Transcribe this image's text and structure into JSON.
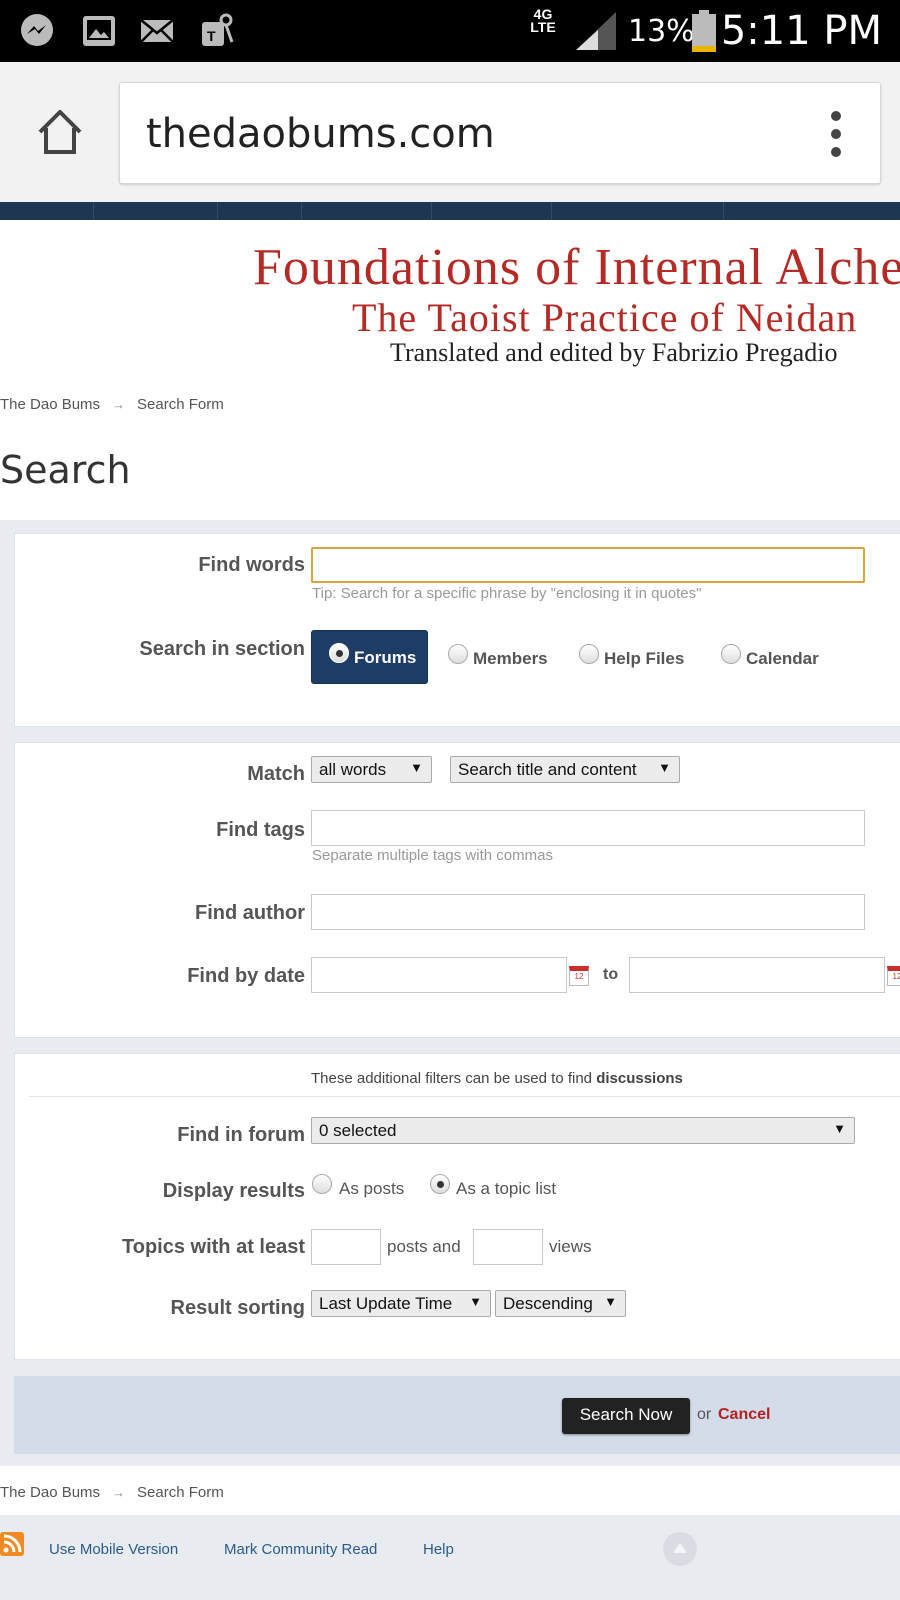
{
  "status_bar": {
    "battery_pct": "13%",
    "time": "5:11 PM",
    "network": "4G LTE"
  },
  "browser": {
    "url": "thedaobums.com"
  },
  "banner": {
    "line1": "Foundations of Internal Alchemy",
    "line2": "The Taoist Practice of Neidan",
    "line3": "Translated and edited by Fabrizio Pregadio"
  },
  "breadcrumb": {
    "home": "The Dao Bums",
    "sep": "→",
    "current": "Search Form"
  },
  "page_title": "Search",
  "form": {
    "find_words_label": "Find words",
    "find_words_value": "",
    "find_words_tip": "Tip: Search for a specific phrase by \"enclosing it in quotes\"",
    "section_label": "Search in section",
    "sections": [
      {
        "label": "Forums",
        "selected": true
      },
      {
        "label": "Members",
        "selected": false
      },
      {
        "label": "Help Files",
        "selected": false
      },
      {
        "label": "Calendar",
        "selected": false
      }
    ],
    "match_label": "Match",
    "match_value": "all words",
    "match_scope_value": "Search title and content",
    "find_tags_label": "Find tags",
    "find_tags_hint": "Separate multiple tags with commas",
    "find_author_label": "Find author",
    "find_by_date_label": "Find by date",
    "date_to": "to",
    "filters_note_pre": "These additional filters can be used to find ",
    "filters_note_strong": "discussions",
    "find_in_forum_label": "Find in forum",
    "find_in_forum_value": "0 selected",
    "display_results_label": "Display results",
    "display_options": [
      {
        "label": "As posts",
        "selected": false
      },
      {
        "label": "As a topic list",
        "selected": true
      }
    ],
    "topics_label": "Topics with at least",
    "posts_and": "posts and",
    "views": "views",
    "sorting_label": "Result sorting",
    "sort_by_value": "Last Update Time",
    "sort_order_value": "Descending",
    "search_now": "Search Now",
    "or": "or",
    "cancel": "Cancel"
  },
  "footer": {
    "mobile": "Use Mobile Version",
    "mark_read": "Mark Community Read",
    "help": "Help"
  },
  "colors": {
    "brand_navy": "#1d3652",
    "banner_red": "#b52a25",
    "cancel_red": "#b22222",
    "focus_border": "#d9a33f"
  }
}
